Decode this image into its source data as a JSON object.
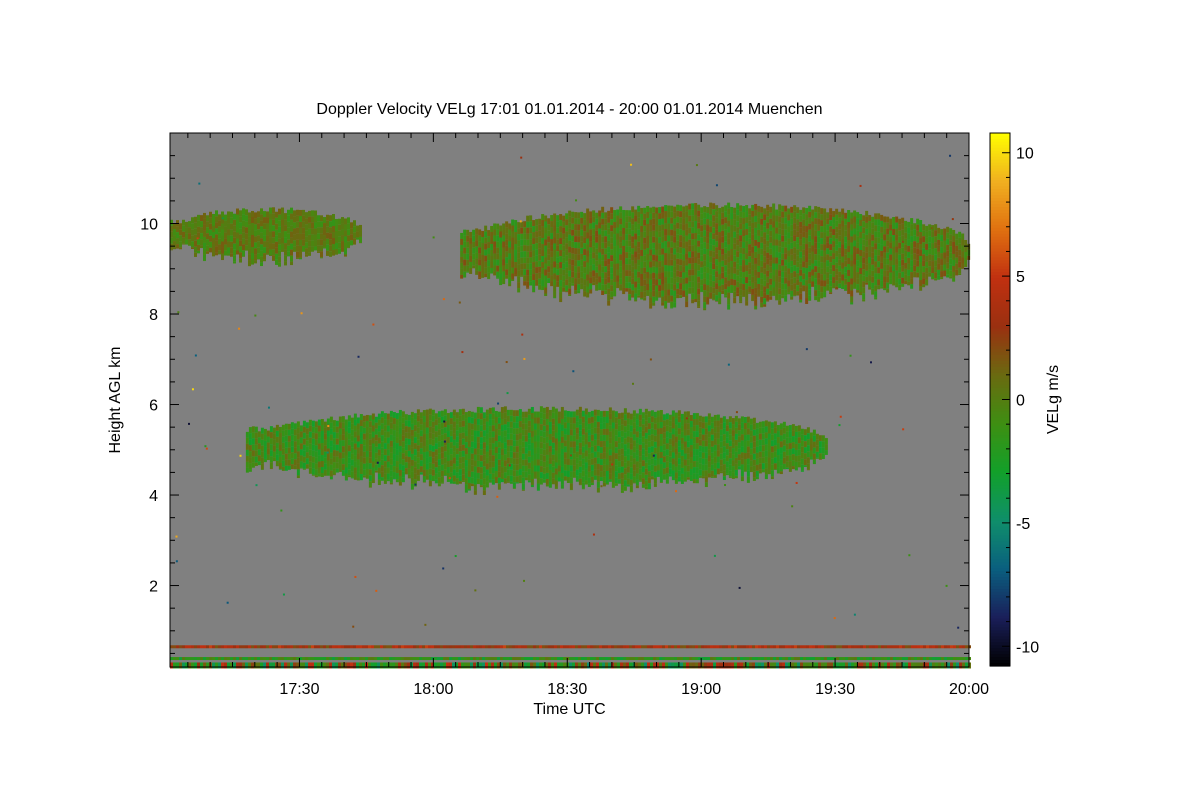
{
  "chart_data": {
    "type": "heatmap",
    "title": "Doppler Velocity VELg   17:01 01.01.2014 - 20:00 01.01.2014 Muenchen",
    "xlabel": "Time UTC",
    "ylabel": "Height AGL km",
    "x_range": [
      "17:01",
      "20:00"
    ],
    "x_ticks": [
      "17:30",
      "18:00",
      "18:30",
      "19:00",
      "19:30",
      "20:00"
    ],
    "ylim": [
      0.2,
      12.0
    ],
    "y_ticks": [
      2,
      4,
      6,
      8,
      10
    ],
    "grid": false,
    "background_value_color": "#808080",
    "colorbar": {
      "label": "VELg m/s",
      "range": [
        -10.8,
        10.8
      ],
      "ticks": [
        -10,
        -5,
        0,
        5,
        10
      ],
      "colors": [
        "#000000",
        "#1a1f5a",
        "#0a5f7f",
        "#0f8f6a",
        "#12a02a",
        "#3e8f12",
        "#6a6a10",
        "#9a3010",
        "#c03010",
        "#e07010",
        "#f0b020",
        "#ffff00"
      ]
    },
    "features": [
      {
        "name": "upper cloud layer (early)",
        "time_start": "17:01",
        "time_end": "17:44",
        "height_bottom_km": 9.2,
        "height_top_km": 10.3,
        "velocity_ms": [
          -1.5,
          1.5
        ]
      },
      {
        "name": "upper cloud layer (main)",
        "time_start": "18:06",
        "time_end": "20:00",
        "height_bottom_km": 8.3,
        "height_top_km": 10.4,
        "velocity_ms": [
          -2,
          2
        ]
      },
      {
        "name": "mid cloud layer",
        "time_start": "17:18",
        "time_end": "19:28",
        "height_bottom_km": 4.2,
        "height_top_km": 5.9,
        "velocity_ms": [
          -3,
          1
        ]
      },
      {
        "name": "near-surface noise",
        "time_start": "17:01",
        "time_end": "20:00",
        "height_bottom_km": 0.2,
        "height_top_km": 0.7,
        "velocity_ms": [
          -5,
          5
        ]
      }
    ]
  }
}
